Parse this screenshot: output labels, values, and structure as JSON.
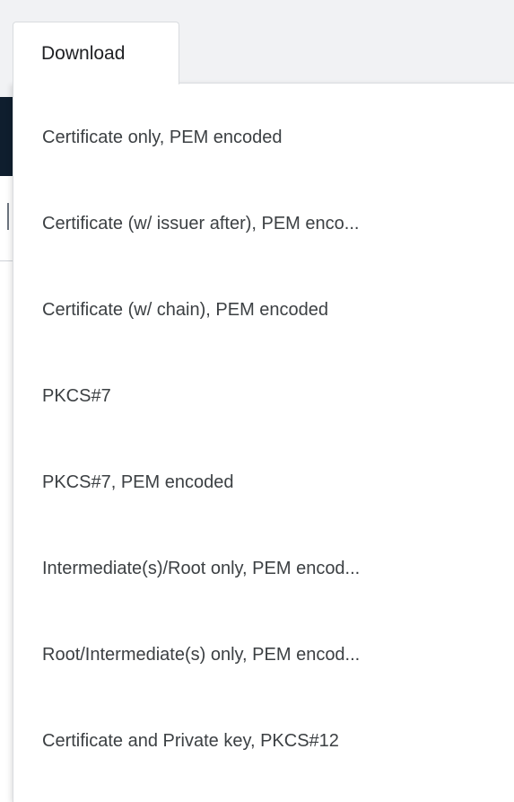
{
  "download_button": {
    "label": "Download"
  },
  "download_menu": {
    "items": [
      {
        "label": "Certificate only, PEM encoded"
      },
      {
        "label": "Certificate (w/ issuer after), PEM enco..."
      },
      {
        "label": "Certificate (w/ chain), PEM encoded"
      },
      {
        "label": "PKCS#7"
      },
      {
        "label": "PKCS#7, PEM encoded"
      },
      {
        "label": "Intermediate(s)/Root only, PEM encod..."
      },
      {
        "label": "Root/Intermediate(s) only, PEM encod..."
      },
      {
        "label": "Certificate and Private key, PKCS#12"
      }
    ]
  }
}
